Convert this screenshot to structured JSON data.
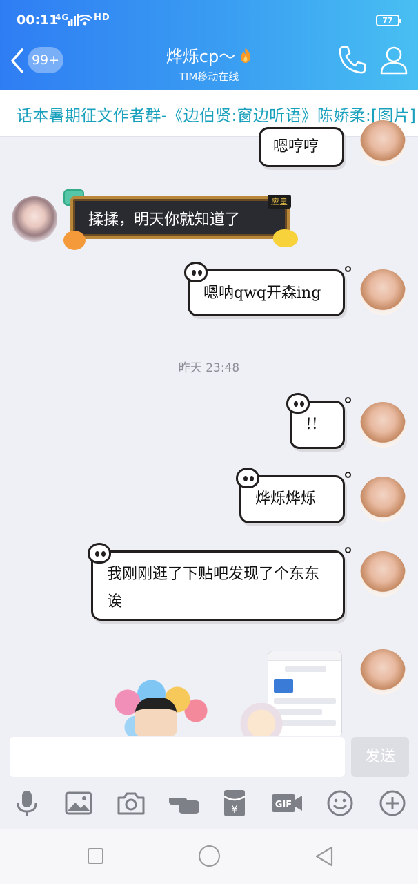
{
  "status_bar": {
    "time": "00:11",
    "signal": "4G",
    "hd": "HD",
    "battery": "77"
  },
  "header": {
    "unread_badge": "99+",
    "title": "烨烁cp～",
    "subtitle": "TIM移动在线",
    "colors": {
      "gradient_start": "#2f7df3",
      "gradient_end": "#48bff2"
    }
  },
  "notice": {
    "text": "话本暑期征文作者群-《边伯贤:窗边听语》陈娇柔:[图片]"
  },
  "messages": [
    {
      "sender": "me",
      "text": "嗯哼哼"
    },
    {
      "sender": "them",
      "text": "揉揉，明天你就知道了",
      "tag": "应皇"
    },
    {
      "sender": "me",
      "text": "嗯呐qwq开森ing"
    },
    {
      "sender": "me",
      "text": "!!"
    },
    {
      "sender": "me",
      "text": "烨烁烨烁"
    },
    {
      "sender": "me",
      "text": "我刚刚逛了下贴吧发现了个东东诶"
    }
  ],
  "timestamp": "昨天 23:48",
  "input": {
    "placeholder": "",
    "send_label": "发送"
  },
  "toolbar": {
    "icons": [
      "microphone-icon",
      "image-icon",
      "camera-icon",
      "poke-icon",
      "red-packet-icon",
      "gif-icon",
      "emoji-icon",
      "plus-icon"
    ]
  }
}
